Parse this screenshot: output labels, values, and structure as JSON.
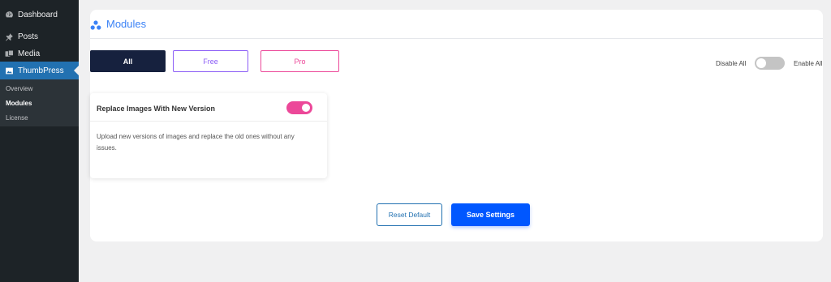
{
  "sidebar": {
    "items": [
      {
        "label": "Dashboard",
        "icon": "dashboard-icon"
      },
      {
        "label": "Posts",
        "icon": "pin-icon"
      },
      {
        "label": "Media",
        "icon": "media-icon"
      },
      {
        "label": "ThumbPress",
        "icon": "thumbpress-icon"
      }
    ],
    "submenu": [
      {
        "label": "Overview"
      },
      {
        "label": "Modules"
      },
      {
        "label": "License"
      }
    ]
  },
  "page": {
    "title": "Modules",
    "filters": {
      "all": "All",
      "free": "Free",
      "pro": "Pro"
    },
    "disable_all": "Disable All",
    "enable_all": "Enable All"
  },
  "module": {
    "title": "Replace Images With New Version",
    "description": "Upload new versions of images and replace the old ones without any issues.",
    "enabled": true
  },
  "actions": {
    "reset": "Reset Default",
    "save": "Save Settings"
  },
  "colors": {
    "accent": "#3b82f6",
    "pro": "#ec4899",
    "free": "#8b5cf6",
    "save": "#0057ff",
    "sidebar": "#1d2327"
  }
}
